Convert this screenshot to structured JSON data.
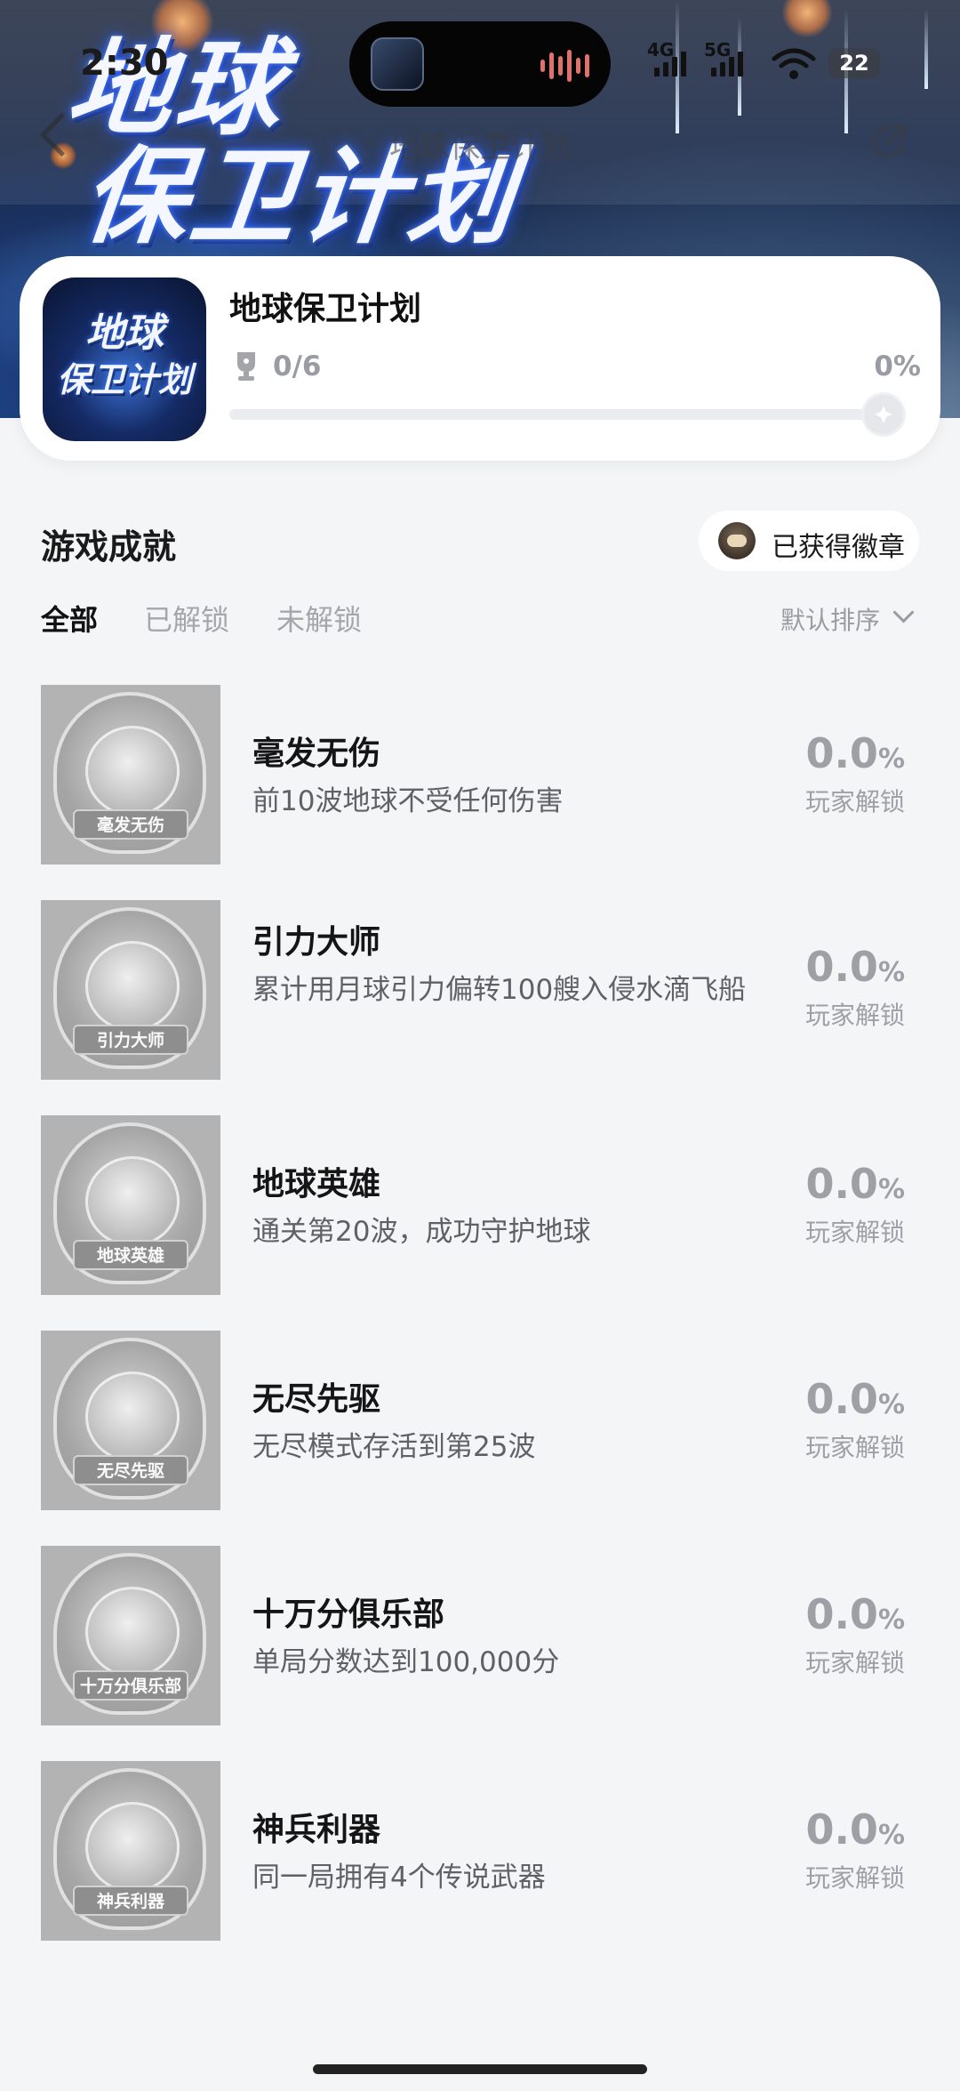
{
  "status_bar": {
    "time": "2:30",
    "net_4g": "4G",
    "net_5g": "5G",
    "battery": "22"
  },
  "banner": {
    "title_line1": "地球",
    "title_line2": "保卫计划"
  },
  "nav": {
    "title": "地球保卫计划"
  },
  "game": {
    "icon_text_line1": "地球",
    "icon_text_line2": "保卫计划",
    "name": "地球保卫计划",
    "progress_text": "0/6",
    "progress_percent": "0%",
    "progress_value": 0
  },
  "section": {
    "title": "游戏成就",
    "badge_button": "已获得徽章"
  },
  "tabs": [
    {
      "label": "全部",
      "active": true
    },
    {
      "label": "已解锁",
      "active": false
    },
    {
      "label": "未解锁",
      "active": false
    }
  ],
  "sort": {
    "label": "默认排序"
  },
  "achievements": [
    {
      "name": "毫发无伤",
      "desc": "前10波地球不受任何伤害",
      "badge_text": "毫发无伤",
      "pct": "0.0",
      "unit": "%",
      "sub": "玩家解锁"
    },
    {
      "name": "引力大师",
      "desc": "累计用月球引力偏转100艘入侵水滴飞船",
      "badge_text": "引力大师",
      "pct": "0.0",
      "unit": "%",
      "sub": "玩家解锁"
    },
    {
      "name": "地球英雄",
      "desc": "通关第20波，成功守护地球",
      "badge_text": "地球英雄",
      "pct": "0.0",
      "unit": "%",
      "sub": "玩家解锁"
    },
    {
      "name": "无尽先驱",
      "desc": "无尽模式存活到第25波",
      "badge_text": "无尽先驱",
      "pct": "0.0",
      "unit": "%",
      "sub": "玩家解锁"
    },
    {
      "name": "十万分俱乐部",
      "desc": "单局分数达到100,000分",
      "badge_text": "十万分俱乐部",
      "pct": "0.0",
      "unit": "%",
      "sub": "玩家解锁"
    },
    {
      "name": "神兵利器",
      "desc": "同一局拥有4个传说武器",
      "badge_text": "神兵利器",
      "pct": "0.0",
      "unit": "%",
      "sub": "玩家解锁"
    }
  ]
}
